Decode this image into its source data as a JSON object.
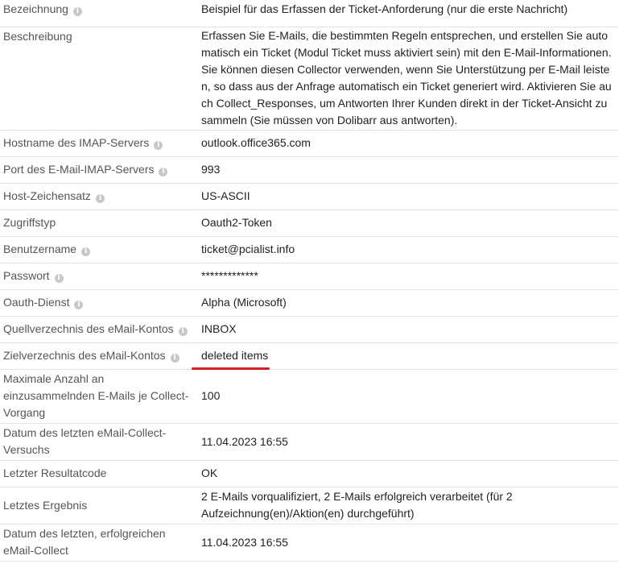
{
  "rows": [
    {
      "key": "bezeichnung",
      "label": "Bezeichnung",
      "info": true,
      "value": "Beispiel für das Erfassen der Ticket-Anforderung (nur die erste Nachricht)"
    },
    {
      "key": "beschreibung",
      "label": "Beschreibung",
      "info": false,
      "value": "Erfassen Sie E-Mails, die bestimmten Regeln entsprechen, und erstellen Sie automatisch ein Ticket (Modul Ticket muss aktiviert sein) mit den E-Mail-Informationen. Sie können diesen Collector verwenden, wenn Sie Unterstützung per E-Mail leisten, so dass aus der Anfrage automatisch ein Ticket generiert wird. Aktivieren Sie auch Collect_Responses, um Antworten Ihrer Kunden direkt in der Ticket-Ansicht zu sammeln (Sie müssen von Dolibarr aus antworten)."
    },
    {
      "key": "hostname",
      "label": "Hostname des IMAP-Servers",
      "info": true,
      "value": "outlook.office365.com"
    },
    {
      "key": "port",
      "label": "Port des E-Mail-IMAP-Servers",
      "info": true,
      "value": "993"
    },
    {
      "key": "charset",
      "label": "Host-Zeichensatz",
      "info": true,
      "value": "US-ASCII"
    },
    {
      "key": "access_type",
      "label": "Zugriffstyp",
      "info": false,
      "value": "Oauth2-Token"
    },
    {
      "key": "username",
      "label": "Benutzername",
      "info": true,
      "value": "ticket@pcialist.info"
    },
    {
      "key": "password",
      "label": "Passwort",
      "info": true,
      "value": "*************"
    },
    {
      "key": "oauth_service",
      "label": "Oauth-Dienst",
      "info": true,
      "value": "Alpha (Microsoft)"
    },
    {
      "key": "source_dir",
      "label": "Quellverzechnis des eMail-Kontos",
      "info": true,
      "value": "INBOX"
    },
    {
      "key": "target_dir",
      "label": "Zielverzechnis des eMail-Kontos",
      "info": true,
      "value": "deleted items",
      "highlight": true
    },
    {
      "key": "max_collect",
      "label": "Maximale Anzahl an einzusammelnden E-Mails je Collect-Vorgang",
      "info": false,
      "value": "100"
    },
    {
      "key": "last_attempt",
      "label": "Datum des letzten eMail-Collect-Versuchs",
      "info": false,
      "value": "11.04.2023 16:55"
    },
    {
      "key": "last_code",
      "label": "Letzter Resultatcode",
      "info": false,
      "value": "OK"
    },
    {
      "key": "last_result",
      "label": "Letztes Ergebnis",
      "info": false,
      "value": "2 E-Mails vorqualifiziert, 2 E-Mails erfolgreich verarbeitet (für 2 Aufzeichnung(en)/Aktion(en) durchgeführt)"
    },
    {
      "key": "last_success",
      "label": "Datum des letzten, erfolgreichen eMail-Collect",
      "info": false,
      "value": "11.04.2023 16:55"
    }
  ],
  "info_icon_glyph": "i",
  "colors": {
    "highlight_underline": "#d42020"
  }
}
